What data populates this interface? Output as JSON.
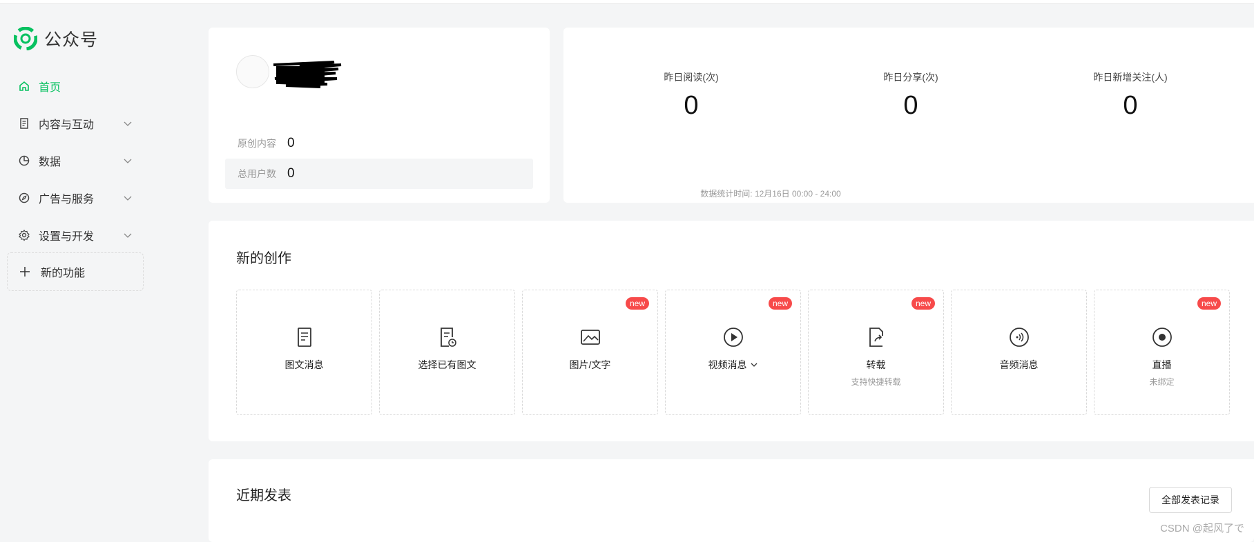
{
  "app": {
    "brand_name": "公众号",
    "accent_color": "#07c160",
    "badge_color": "#f74a4a"
  },
  "sidebar": {
    "items": [
      {
        "label": "首页",
        "icon": "home-icon",
        "active": true
      },
      {
        "label": "内容与互动",
        "icon": "document-icon",
        "expandable": true
      },
      {
        "label": "数据",
        "icon": "pie-chart-icon",
        "expandable": true
      },
      {
        "label": "广告与服务",
        "icon": "compass-icon",
        "expandable": true
      },
      {
        "label": "设置与开发",
        "icon": "gear-icon",
        "expandable": true
      }
    ],
    "new_feature_label": "新的功能"
  },
  "account": {
    "stats": [
      {
        "label": "原创内容",
        "value": "0"
      },
      {
        "label": "总用户数",
        "value": "0"
      }
    ]
  },
  "metrics": {
    "items": [
      {
        "label": "昨日阅读(次)",
        "value": "0"
      },
      {
        "label": "昨日分享(次)",
        "value": "0"
      },
      {
        "label": "昨日新增关注(人)",
        "value": "0"
      }
    ],
    "note": "数据统计时间: 12月16日 00:00 - 24:00"
  },
  "create": {
    "title": "新的创作",
    "tiles": [
      {
        "label": "图文消息",
        "icon": "article-icon",
        "badge": "",
        "sub": ""
      },
      {
        "label": "选择已有图文",
        "icon": "article-clock-icon",
        "badge": "",
        "sub": ""
      },
      {
        "label": "图片/文字",
        "icon": "image-icon",
        "badge": "new",
        "sub": ""
      },
      {
        "label": "视频消息",
        "icon": "play-icon",
        "badge": "new",
        "sub": "",
        "dropdown": true
      },
      {
        "label": "转载",
        "icon": "share-doc-icon",
        "badge": "new",
        "sub": "支持快捷转载"
      },
      {
        "label": "音频消息",
        "icon": "audio-icon",
        "badge": "",
        "sub": ""
      },
      {
        "label": "直播",
        "icon": "live-icon",
        "badge": "new",
        "sub": "未绑定"
      }
    ]
  },
  "recent": {
    "title": "近期发表",
    "all_button": "全部发表记录"
  },
  "watermark": "CSDN @起风了で"
}
